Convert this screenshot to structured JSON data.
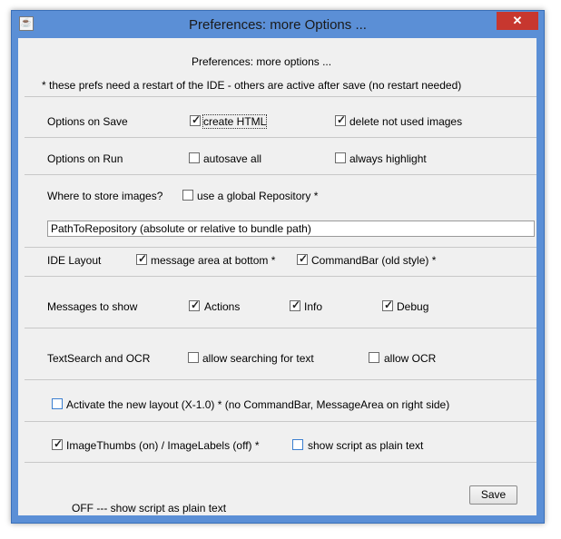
{
  "window": {
    "title": "Preferences: more Options ...",
    "close_glyph": "✕",
    "app_icon": "java-icon"
  },
  "header": {
    "title": "Preferences: more options ...",
    "note": "* these prefs need a restart of the IDE - others are active after save (no restart needed)"
  },
  "options_on_save": {
    "label": "Options on Save",
    "create_html": {
      "label": "create HTML",
      "checked": true
    },
    "delete_images": {
      "label": "delete not used images",
      "checked": true
    }
  },
  "options_on_run": {
    "label": "Options on Run",
    "autosave": {
      "label": "autosave all",
      "checked": false
    },
    "highlight": {
      "label": "always highlight",
      "checked": false
    }
  },
  "images": {
    "label": "Where to store images?",
    "global_repo": {
      "label": "use a global Repository *",
      "checked": false
    },
    "path_value": "PathToRepository (absolute or relative to bundle path)"
  },
  "ide_layout": {
    "label": "IDE Layout",
    "message_area": {
      "label": "message area at bottom *",
      "checked": true
    },
    "commandbar": {
      "label": "CommandBar (old style) *",
      "checked": true
    }
  },
  "messages": {
    "label": "Messages to show",
    "actions": {
      "label": "Actions",
      "checked": true
    },
    "info": {
      "label": "Info",
      "checked": true
    },
    "debug": {
      "label": "Debug",
      "checked": true
    }
  },
  "textsearch": {
    "label": "TextSearch and OCR",
    "searching": {
      "label": "allow searching for text",
      "checked": false
    },
    "ocr": {
      "label": "allow OCR",
      "checked": false
    }
  },
  "new_layout": {
    "label": "Activate the new layout (X-1.0) *  (no CommandBar, MessageArea on right side)",
    "checked": false
  },
  "thumbs": {
    "imagethumbs": {
      "label": "ImageThumbs (on) / ImageLabels (off) *",
      "checked": true
    },
    "plain_text": {
      "label": "show script as plain text",
      "checked": false
    }
  },
  "footer": {
    "save_label": "Save",
    "status": "OFF --- show script as plain text"
  },
  "colors": {
    "titlebar": "#5b8fd6",
    "close": "#c7372f",
    "panel": "#f0f0f0",
    "checkbox_focus": "#3c7fd0"
  }
}
